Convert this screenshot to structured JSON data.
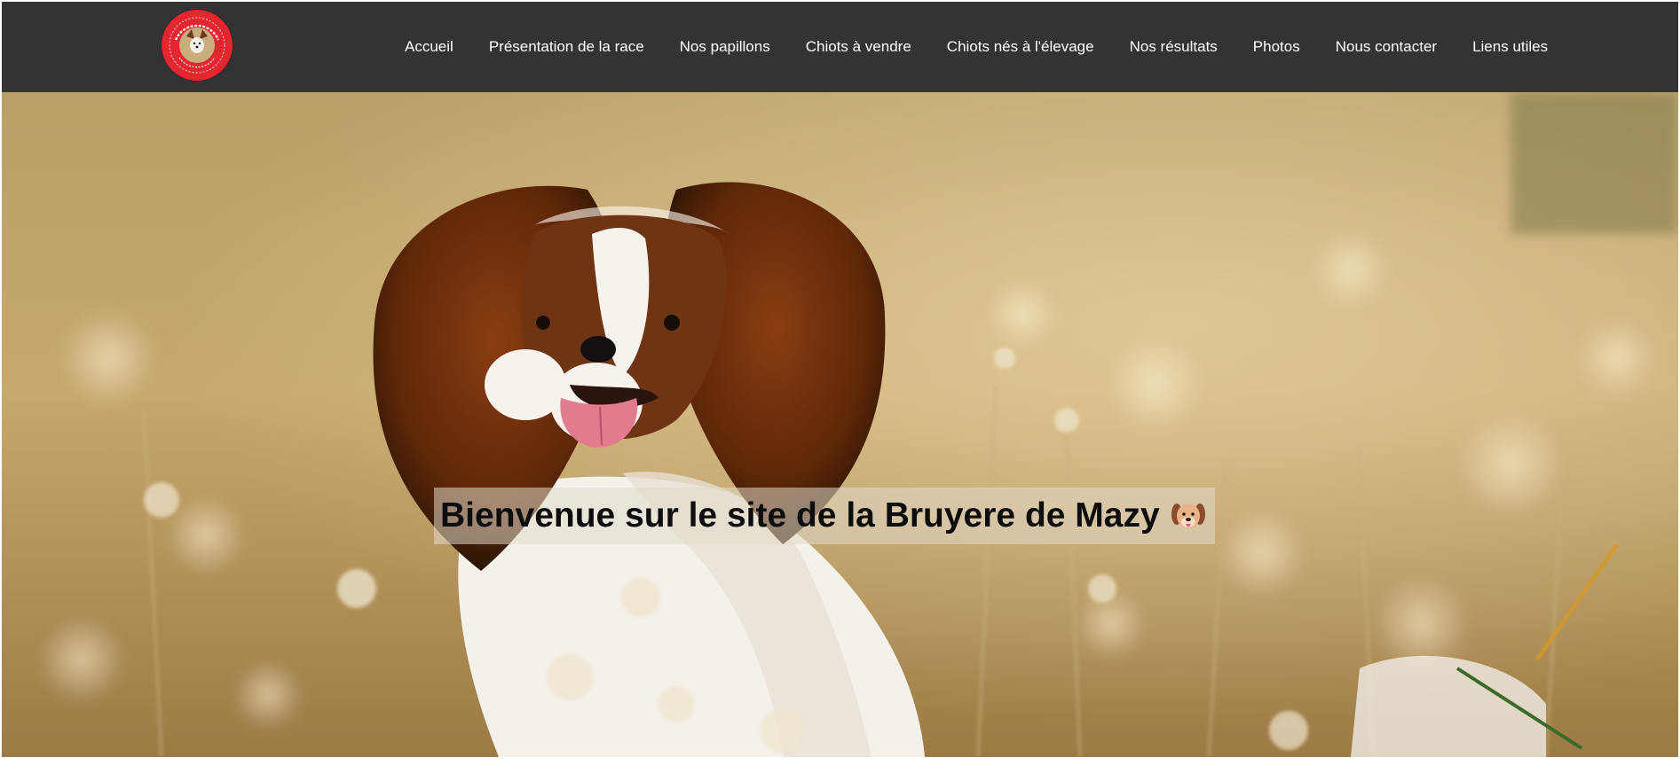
{
  "logo": {
    "alt": "Les Épagneuls Papillons de la Bruyère de Mazy",
    "icon": "papillon-dog-logo"
  },
  "nav": {
    "items": [
      {
        "label": "Accueil"
      },
      {
        "label": "Présentation de la race"
      },
      {
        "label": "Nos papillons"
      },
      {
        "label": "Chiots à vendre"
      },
      {
        "label": "Chiots nés à l'élevage"
      },
      {
        "label": "Nos résultats"
      },
      {
        "label": "Photos"
      },
      {
        "label": "Nous contacter"
      },
      {
        "label": "Liens utiles"
      }
    ]
  },
  "hero": {
    "title": "Bienvenue sur le site de la Bruyere de Mazy",
    "emoji_icon": "dog-face-icon",
    "photo": "papillon-dog-in-meadow"
  },
  "colors": {
    "navbar_bg": "#333333",
    "logo_red": "#e3262f",
    "nav_text": "#ffffff"
  }
}
